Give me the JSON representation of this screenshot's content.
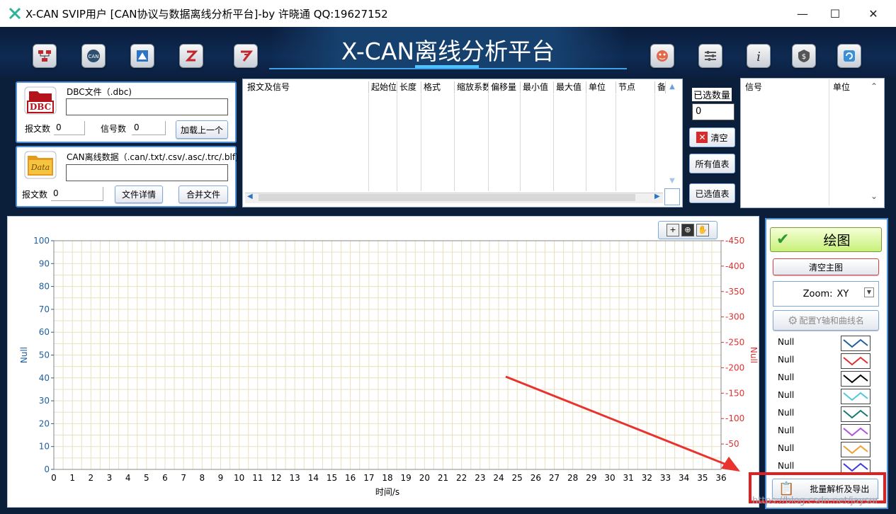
{
  "window": {
    "title": "X-CAN SVIP用户 [CAN协议与数据离线分析平台]-by 许晓通 QQ:19627152",
    "minimize": "—",
    "maximize": "☐",
    "close": "✕"
  },
  "header": {
    "title": "X-CAN离线分析平台",
    "left_tools": [
      "network-tool-icon",
      "can-tool-icon",
      "map-tool-icon",
      "zip-tool-icon",
      "flash-tool-icon"
    ],
    "right_tools": [
      "face-icon",
      "settings-sliders-icon",
      "info-icon",
      "dollar-shield-icon",
      "refresh-icon"
    ]
  },
  "dbc": {
    "label": "DBC文件（.dbc)",
    "path": "",
    "msg_count_label": "报文数",
    "msg_count": "0",
    "sig_count_label": "信号数",
    "sig_count": "0",
    "load_button": "加载上一个",
    "icon_text": "DBC"
  },
  "data_file": {
    "label": "CAN离线数据（.can/.txt/.csv/.asc/.trc/.blf)",
    "path": "",
    "msg_count_label": "报文数",
    "msg_count": "0",
    "detail_button": "文件详情",
    "merge_button": "合并文件",
    "icon_text": "Data"
  },
  "signal_table": {
    "columns": [
      "报文及信号",
      "起始位",
      "长度",
      "格式",
      "缩放系数",
      "偏移量",
      "最小值",
      "最大值",
      "单位",
      "节点",
      "备"
    ]
  },
  "selection": {
    "count_label": "已选数量",
    "count": "0",
    "clear_button": "清空",
    "all_values_button": "所有值表",
    "selected_values_button": "已选值表"
  },
  "selected_list": {
    "columns": [
      "信号",
      "单位"
    ]
  },
  "chart_data": {
    "type": "line",
    "xlabel": "时间/s",
    "ylabel": "Null",
    "y2label": "Null",
    "xlim": [
      0,
      36
    ],
    "ylim": [
      0,
      100
    ],
    "y2lim": [
      0,
      450
    ],
    "x_ticks": [
      "0",
      "1",
      "2",
      "3",
      "4",
      "5",
      "6",
      "7",
      "8",
      "9",
      "10",
      "11",
      "12",
      "13",
      "14",
      "15",
      "16",
      "17",
      "18",
      "19",
      "20",
      "21",
      "22",
      "23",
      "24",
      "25",
      "26",
      "27",
      "28",
      "29",
      "30",
      "31",
      "32",
      "33",
      "34",
      "35",
      "36"
    ],
    "y_ticks": [
      "100",
      "90",
      "80",
      "70",
      "60",
      "50",
      "40",
      "30",
      "20",
      "10",
      "0"
    ],
    "y2_ticks": [
      "-450",
      "-400",
      "-350",
      "-300",
      "-250",
      "-200",
      "-150",
      "-100",
      "-50"
    ],
    "grid": true,
    "series": []
  },
  "right_panel": {
    "plot_button": "绘图",
    "clear_main_button": "清空主图",
    "zoom_label": "Zoom:",
    "zoom_value": "XY",
    "config_button": "配置Y轴和曲线名",
    "export_button": "批量解析及导出",
    "legend": [
      {
        "name": "Null",
        "color": "#1f5f9f"
      },
      {
        "name": "Null",
        "color": "#e03030"
      },
      {
        "name": "Null",
        "color": "#000000"
      },
      {
        "name": "Null",
        "color": "#4ec8e0"
      },
      {
        "name": "Null",
        "color": "#157a6e"
      },
      {
        "name": "Null",
        "color": "#b050e0"
      },
      {
        "name": "Null",
        "color": "#f0a030"
      },
      {
        "name": "Null",
        "color": "#3a3ae0"
      }
    ]
  },
  "watermark": "https://blog.csdn.net/jaysur",
  "colors": {
    "accent": "#4f8fd6",
    "highlight": "#e02020",
    "y2_axis": "#e03030",
    "y_axis": "#1f5f9f"
  }
}
